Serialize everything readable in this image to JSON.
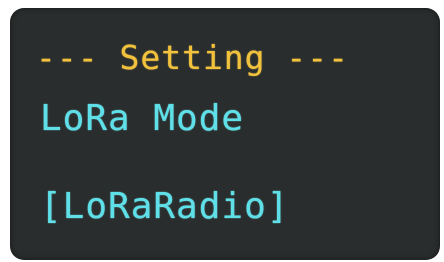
{
  "screen": {
    "header": "--- Setting ---",
    "setting_name": "LoRa Mode",
    "setting_value": "[LoRaRadio]",
    "colors": {
      "background": "#2a2d2d",
      "header": "#f2c23c",
      "text": "#5fe0e8"
    }
  }
}
